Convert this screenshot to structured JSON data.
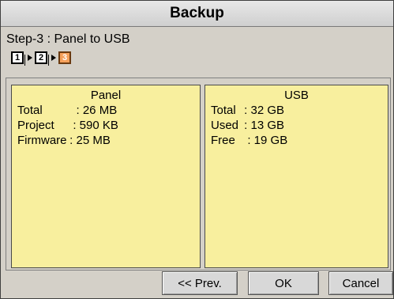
{
  "window": {
    "title": "Backup"
  },
  "step": {
    "label": "Step-3 : Panel to USB",
    "items": [
      {
        "number": "1",
        "state": "done"
      },
      {
        "number": "2",
        "state": "done"
      },
      {
        "number": "3",
        "state": "active"
      }
    ]
  },
  "panel": {
    "title": "Panel",
    "rows": [
      {
        "key": "Total",
        "sep": "   : ",
        "value": "26 MB"
      },
      {
        "key": "Project",
        "sep": "  : ",
        "value": "590 KB"
      },
      {
        "key": "Firmware",
        "sep": " : ",
        "value": "25 MB"
      }
    ]
  },
  "usb": {
    "title": "USB",
    "rows": [
      {
        "key": "Total",
        "sep": " : ",
        "value": "32 GB"
      },
      {
        "key": "Used",
        "sep": " : ",
        "value": "13 GB"
      },
      {
        "key": "Free",
        "sep": "  : ",
        "value": "19 GB"
      }
    ]
  },
  "buttons": {
    "prev": "<< Prev.",
    "ok": "OK",
    "cancel": "Cancel"
  },
  "colors": {
    "box_bg": "#f8ef9e",
    "active_step": "#f5a05a"
  }
}
